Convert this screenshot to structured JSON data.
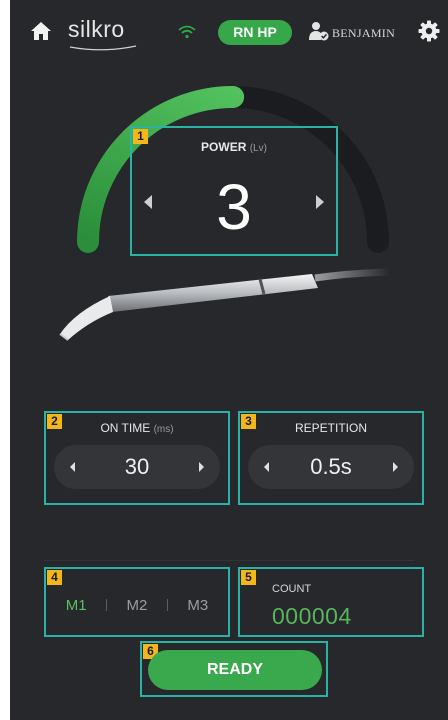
{
  "header": {
    "logo": "silkro",
    "mode_pill": "RN HP",
    "username": "BENJAMIN"
  },
  "power": {
    "badge": "1",
    "label": "POWER",
    "unit": "(Lv)",
    "value": "3",
    "gauge_fill_fraction": 0.5
  },
  "on_time": {
    "badge": "2",
    "label": "ON TIME",
    "unit": "(ms)",
    "value": "30"
  },
  "repetition": {
    "badge": "3",
    "label": "REPETITION",
    "value": "0.5s"
  },
  "modes": {
    "badge": "4",
    "items": [
      "M1",
      "M2",
      "M3"
    ],
    "active": "M1"
  },
  "count": {
    "badge": "5",
    "label": "COUNT",
    "value": "000004"
  },
  "ready": {
    "badge": "6",
    "label": "READY"
  },
  "colors": {
    "background": "#26282c",
    "accent_green": "#3aa84c",
    "highlight_teal": "#28b3a5",
    "badge_yellow": "#f3b61b"
  },
  "icons": {
    "home": "home-icon",
    "wifi": "wifi-icon",
    "user": "user-check-icon",
    "settings": "gear-icon"
  }
}
